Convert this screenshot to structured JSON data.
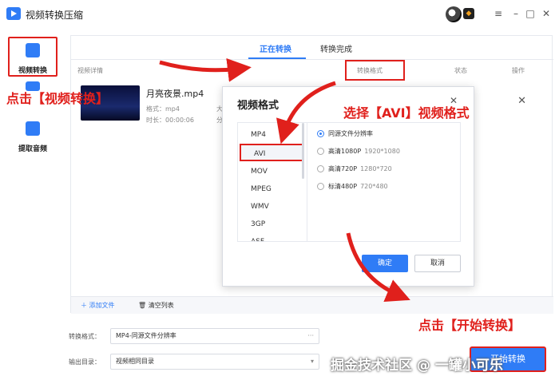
{
  "app": {
    "title": "视频转换压缩"
  },
  "window_controls": {
    "menu": "≡",
    "minimize": "–",
    "maximize": "□",
    "close": "✕"
  },
  "sidebar": {
    "items": [
      {
        "label": "视频转换",
        "icon": "convert-icon"
      },
      {
        "label": "",
        "icon": "compress-icon"
      },
      {
        "label": "提取音频",
        "icon": "audio-extract-icon"
      }
    ]
  },
  "tabs": {
    "converting": "正在转换",
    "completed": "转换完成"
  },
  "table": {
    "columns": {
      "details": "视频详情",
      "format": "转换格式",
      "status": "状态",
      "actions": "操作"
    }
  },
  "file": {
    "name": "月亮夜景.mp4",
    "format_line": "格式：mp4",
    "duration_line": "时长：00:00:06",
    "size_fragment": "大小",
    "resolution_fragment": "分辨"
  },
  "bottom_bar": {
    "add_file": "添加文件",
    "clear_list": "清空列表"
  },
  "settings": {
    "format_label": "转换格式：",
    "format_value": "MP4-同源文件分辨率",
    "format_suffix": "···",
    "output_label": "输出目录：",
    "output_value": "视频相同目录",
    "output_suffix": "▾"
  },
  "dialog": {
    "title": "视频格式",
    "formats": [
      "MP4",
      "AVI",
      "MOV",
      "MPEG",
      "WMV",
      "3GP",
      "ASF"
    ],
    "selected_format": "AVI",
    "resolutions": [
      {
        "label": "同源文件分辨率",
        "dims": "",
        "selected": true
      },
      {
        "label": "高清1080P",
        "dims": "1920*1080",
        "selected": false
      },
      {
        "label": "高清720P",
        "dims": "1280*720",
        "selected": false
      },
      {
        "label": "标清480P",
        "dims": "720*480",
        "selected": false
      }
    ],
    "ok": "确定",
    "cancel": "取消"
  },
  "annotations": {
    "click_convert": "点击【视频转换】",
    "select_avi": "选择【AVI】视频格式",
    "click_start": "点击【开始转换】"
  },
  "start_button": {
    "label": "开始转换"
  },
  "watermark": "掘金技术社区 @ 一罐小可乐",
  "colors": {
    "accent": "#2f7cf6",
    "annotation": "#e0201c"
  }
}
